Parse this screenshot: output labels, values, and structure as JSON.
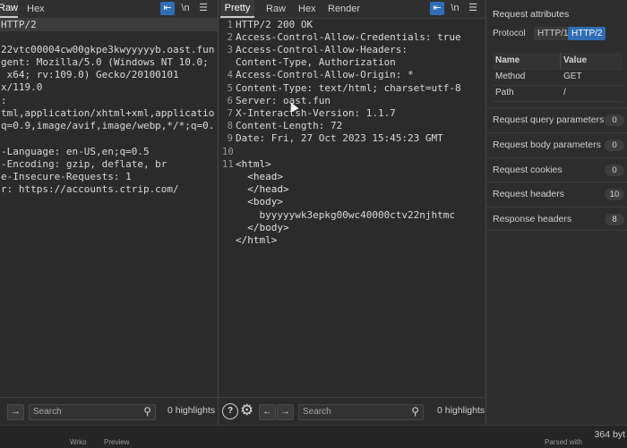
{
  "request": {
    "tabs": [
      "Raw",
      "Hex"
    ],
    "lines": [
      "HTTP/2",
      "",
      "22vtc00004cw00gkpe3kwyyyyyb.oast.fun",
      "gent: Mozilla/5.0 (Windows NT 10.0;",
      " x64; rv:109.0) Gecko/20100101",
      "x/119.0",
      ":",
      "tml,application/xhtml+xml,applicatio",
      "q=0.9,image/avif,image/webp,*/*;q=0.",
      "",
      "-Language: en-US,en;q=0.5",
      "-Encoding: gzip, deflate, br",
      "e-Insecure-Requests: 1",
      "r: https://accounts.ctrip.com/"
    ],
    "icons": [
      "wrap-icon",
      "newline-icon",
      "menu-icon"
    ],
    "search_placeholder": "Search",
    "highlights": "0 highlights"
  },
  "response": {
    "tabs": [
      "Pretty",
      "Raw",
      "Hex",
      "Render"
    ],
    "lines": [
      {
        "n": "1",
        "t": "HTTP/2 200 OK"
      },
      {
        "n": "2",
        "t": "Access-Control-Allow-Credentials: true"
      },
      {
        "n": "3",
        "t": "Access-Control-Allow-Headers:"
      },
      {
        "n": "",
        "t": "Content-Type, Authorization"
      },
      {
        "n": "4",
        "t": "Access-Control-Allow-Origin: *"
      },
      {
        "n": "5",
        "t": "Content-Type: text/html; charset=utf-8"
      },
      {
        "n": "6",
        "t": "Server: oast.fun"
      },
      {
        "n": "7",
        "t": "X-Interactsh-Version: 1.1.7"
      },
      {
        "n": "8",
        "t": "Content-Length: 72"
      },
      {
        "n": "9",
        "t": "Date: Fri, 27 Oct 2023 15:45:23 GMT"
      },
      {
        "n": "10",
        "t": ""
      },
      {
        "n": "11",
        "t": "<html>"
      },
      {
        "n": "",
        "t": "  <head>"
      },
      {
        "n": "",
        "t": "  </head>"
      },
      {
        "n": "",
        "t": "  <body>"
      },
      {
        "n": "",
        "t": "    byyyyywk3epkg00wc40000ctv22njhtmc"
      },
      {
        "n": "",
        "t": "  </body>"
      },
      {
        "n": "",
        "t": "</html>"
      }
    ],
    "search_placeholder": "Search",
    "highlights": "0 highlights"
  },
  "inspector": {
    "title": "Request attributes",
    "protocol_label": "Protocol",
    "protocol_options": [
      "HTTP/1",
      "HTTP/2"
    ],
    "protocol_selected": "HTTP/2",
    "table_headers": [
      "Name",
      "Value"
    ],
    "table_rows": [
      {
        "name": "Method",
        "value": "GET"
      },
      {
        "name": "Path",
        "value": "/"
      }
    ],
    "sections": [
      {
        "label": "Request query parameters",
        "count": "0"
      },
      {
        "label": "Request body parameters",
        "count": "0"
      },
      {
        "label": "Request cookies",
        "count": "0"
      },
      {
        "label": "Request headers",
        "count": "10"
      },
      {
        "label": "Response headers",
        "count": "8"
      }
    ]
  },
  "status": {
    "bytes": "364 byt",
    "fragments": [
      "Wrko",
      "Preview",
      "Parsed with"
    ]
  },
  "colors": {
    "accent": "#2f6db5",
    "background": "#2b2b2b"
  }
}
